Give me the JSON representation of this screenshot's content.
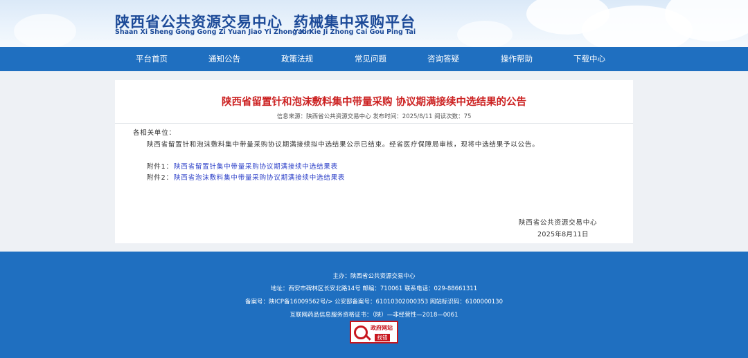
{
  "header": {
    "title_cn_1": "陕西省公共资源交易中心",
    "title_cn_2": "药械集中采购平台",
    "title_en_1": "Shaan Xi Sheng Gong Gong Zi Yuan Jiao Yi Zhong Xin",
    "title_en_2": "Yao Xie Ji Zhong Cai Gou Ping Tai"
  },
  "nav": {
    "items": [
      "平台首页",
      "通知公告",
      "政策法规",
      "常见问题",
      "咨询答疑",
      "操作帮助",
      "下载中心"
    ]
  },
  "article": {
    "title": "陕西省留置针和泡沫敷料集中带量采购 协议期满接续中选结果的公告",
    "meta": "信息来源：陕西省公共资源交易中心 发布时间：2025/8/11 阅读次数：75",
    "salutation": "各相关单位：",
    "paragraph": "陕西省留置针和泡沫敷料集中带量采购协议期满接续拟中选结果公示已结束。经省医疗保障局审核，现将中选结果予以公告。",
    "attachments": [
      {
        "label": "附件1：",
        "link": "陕西省留置针集中带量采购协议期满接续中选结果表"
      },
      {
        "label": "附件2：",
        "link": "陕西省泡沫敷料集中带量采购协议期满接续中选结果表"
      }
    ],
    "signature_org": "陕西省公共资源交易中心",
    "signature_date": "2025年8月11日"
  },
  "footer": {
    "host": "主办：陕西省公共资源交易中心",
    "address": "地址：西安市碑林区长安北路14号 邮编：710061 联系电话：029-88661311",
    "record": "备案号：陕ICP备16009562号/> 公安部备案号：61010302000353 网站标识码：6100000130",
    "license": "互联网药品信息服务资格证书：（陕）—非经营性—2018—0061",
    "badge_top": "政府网站",
    "badge_bottom": "找错"
  },
  "colors": {
    "nav_bg": "#1f6fc0",
    "title_red": "#cc2222",
    "link_blue": "#2b3fc8",
    "header_text": "#1c4a98"
  }
}
